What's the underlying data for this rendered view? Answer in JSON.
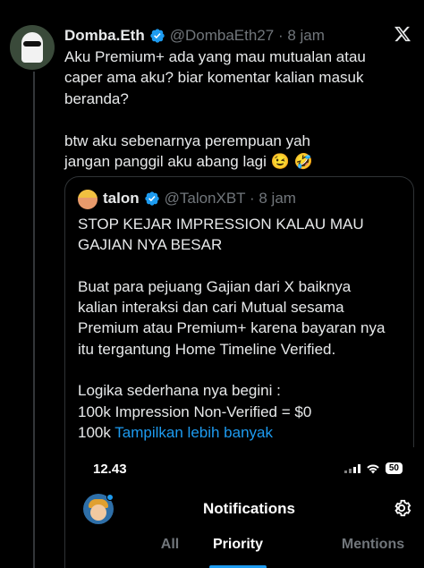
{
  "tweet": {
    "author_name": "Domba.Eth",
    "handle_time": "@DombaEth27 · 8 jam",
    "text": "Aku Premium+ ada yang mau mutualan atau\ncaper ama aku? biar komentar kalian masuk\nberanda?\n\nbtw aku sebenarnya perempuan yah\njangan panggil aku abang lagi 😉 🤣"
  },
  "quote": {
    "author_name": "talon",
    "handle_time": "@TalonXBT · 8 jam",
    "text": "STOP KEJAR IMPRESSION KALAU MAU\nGAJIAN NYA BESAR\n\nBuat para pejuang Gajian dari X baiknya\nkalian interaksi dan cari Mutual sesama\nPremium atau Premium+ karena bayaran nya\nitu tergantung Home Timeline Verified.\n\nLogika sederhana nya begini :\n100k Impression Non-Verified = $0\n100k ",
    "more_link": "Tampilkan lebih banyak"
  },
  "screenshot": {
    "time": "12.43",
    "battery": "50",
    "title": "Notifications",
    "tabs": [
      "All",
      "Priority",
      "Mentions"
    ],
    "active_tab": "Priority"
  },
  "colors": {
    "background": "#000000",
    "text": "#e7e9ea",
    "secondary_text": "#71767b",
    "accent": "#1d9bf0",
    "border": "#2f3336"
  },
  "icons": [
    "verified-badge-icon",
    "x-logo-icon",
    "signal-icon",
    "wifi-icon",
    "battery-icon",
    "gear-icon"
  ]
}
